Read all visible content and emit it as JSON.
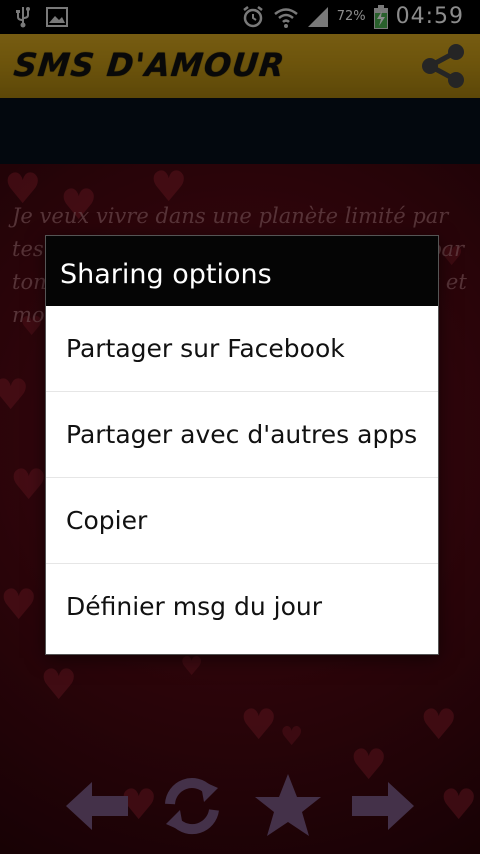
{
  "status_bar": {
    "battery_percent": "72%",
    "time": "04:59",
    "icons": [
      "usb-icon",
      "image-icon",
      "alarm-icon",
      "wifi-icon",
      "signal-icon",
      "battery-charging-icon"
    ]
  },
  "app": {
    "title": "SMS D'AMOUR",
    "share_icon": "share-icon",
    "accent_color": "#c79a17"
  },
  "message": {
    "text": "Je veux vivre dans une planète limité par tes bras, éclairée par tes yeux, dirigée par ton cœur où tous les habitants sont tout et morts"
  },
  "dialog": {
    "title": "Sharing options",
    "options": [
      {
        "label": "Partager sur Facebook"
      },
      {
        "label": "Partager avec d'autres apps"
      },
      {
        "label": "Copier"
      },
      {
        "label": "Définier msg du jour"
      }
    ]
  },
  "bottom_nav": {
    "items": [
      "previous-arrow-icon",
      "refresh-icon",
      "star-icon",
      "next-arrow-icon"
    ],
    "color": "#7d5a86"
  }
}
